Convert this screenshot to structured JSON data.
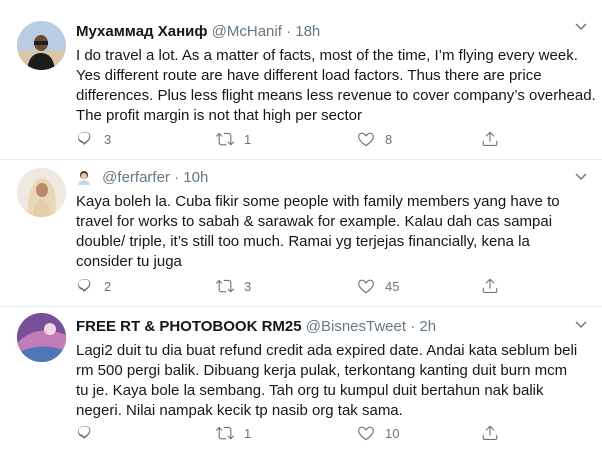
{
  "tweets": [
    {
      "name": "Мухаммад Ханиф",
      "handle": "@McHanif",
      "dot": "·",
      "time": "18h",
      "lines": [
        "I do travel a lot. As a matter of facts, most of the time, I’m flying every week.",
        "Yes different route are have different load factors. Thus there are price",
        "differences. Plus less flight means less revenue to cover company’s overhead.",
        "The profit margin is not that high per sector"
      ],
      "replies": "3",
      "retweets": "1",
      "likes": "8"
    },
    {
      "name": "",
      "handle": "@ferfarfer",
      "dot": "·",
      "time": "10h",
      "lines": [
        "Kaya boleh la. Cuba fikir some people with family members yang have to",
        "travel for works to sabah & sarawak for example. Kalau dah cas sampai",
        "double/ triple, it’s still too much. Ramai yg terjejas financially, kena la",
        "consider tu juga"
      ],
      "replies": "2",
      "retweets": "3",
      "likes": "45"
    },
    {
      "name": "FREE RT & PHOTOBOOK RM25",
      "handle": "@BisnesTweet",
      "dot": "·",
      "time": "2h",
      "lines": [
        "Lagi2 duit tu dia buat refund credit ada expired date. Andai kata seblum beli",
        "rm 500 pergi balik. Dibuang kerja pulak, terkontang kanting duit burn mcm",
        "tu je. Kaya bole la sembang. Tah org tu kumpul duit bertahun nak balik",
        "negeri. Nilai nampak kecik tp nasib org tak sama."
      ],
      "replies": "",
      "retweets": "1",
      "likes": "10"
    }
  ],
  "colors": {
    "text": "#14171a",
    "secondary": "#657786",
    "divider": "#e6ecf0"
  },
  "icons": [
    "reply-icon",
    "retweet-icon",
    "like-icon",
    "share-icon",
    "chevron-down-icon"
  ]
}
